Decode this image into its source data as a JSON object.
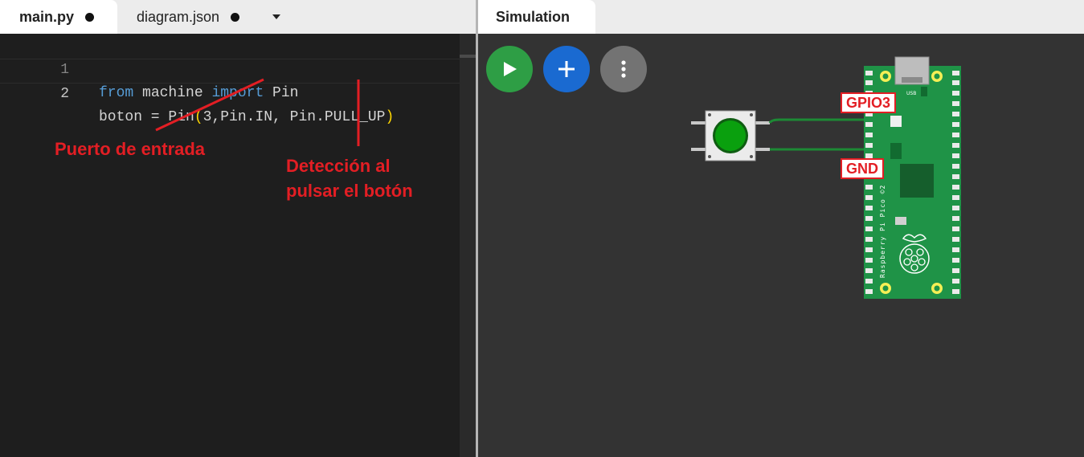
{
  "editor": {
    "tabs": [
      {
        "label": "main.py",
        "active": true,
        "modified": true
      },
      {
        "label": "diagram.json",
        "active": false,
        "modified": true
      }
    ],
    "lines": [
      {
        "number": "1"
      },
      {
        "number": "2"
      }
    ]
  },
  "annotations": {
    "port_label": "Puerto de entrada",
    "detect_line1": "Detección  al",
    "detect_line2": "pulsar el botón"
  },
  "simulation": {
    "tab_label": "Simulation",
    "buttons": {
      "play_icon": "play-icon",
      "add_icon": "plus-icon",
      "more_icon": "more-vertical-icon"
    },
    "board": {
      "name": "Raspberry Pi Pico ©2",
      "usb_label": "USB"
    },
    "pin_labels": {
      "gpio": "GPIO3",
      "gnd": "GND"
    }
  },
  "colors": {
    "annotation": "#e31e24",
    "board": "#1f9347",
    "play": "#2e9e45",
    "add": "#1a6ad1",
    "more": "#737373",
    "wire": "#1d8a35"
  }
}
